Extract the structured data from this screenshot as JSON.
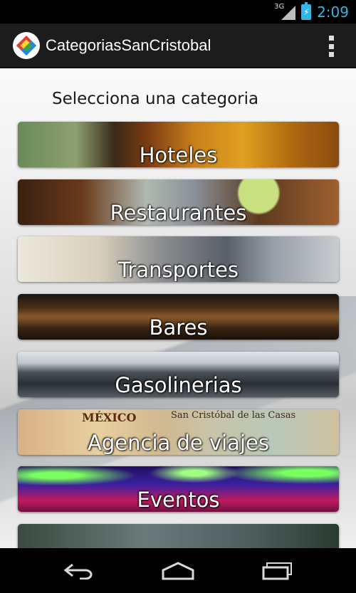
{
  "status_bar": {
    "network": "3G",
    "time": "2:09"
  },
  "action_bar": {
    "title": "CategoriasSanCristobal",
    "app_icon": "app-logo-icon",
    "overflow_icon": "overflow-menu-icon"
  },
  "content": {
    "heading": "Selecciona una categoria",
    "categories": [
      {
        "label": "Hoteles"
      },
      {
        "label": "Restaurantes"
      },
      {
        "label": "Transportes"
      },
      {
        "label": "Bares"
      },
      {
        "label": "Gasolinerias"
      },
      {
        "label": "Agencia de viajes",
        "map_text_1": "MÉXICO",
        "map_text_2": "San Cristóbal de las Casas"
      },
      {
        "label": "Eventos"
      }
    ]
  },
  "nav_bar": {
    "back_icon": "back-icon",
    "home_icon": "home-icon",
    "recents_icon": "recents-icon"
  },
  "colors": {
    "accent": "#33b5e5",
    "action_bar": "#1c1c1c"
  }
}
